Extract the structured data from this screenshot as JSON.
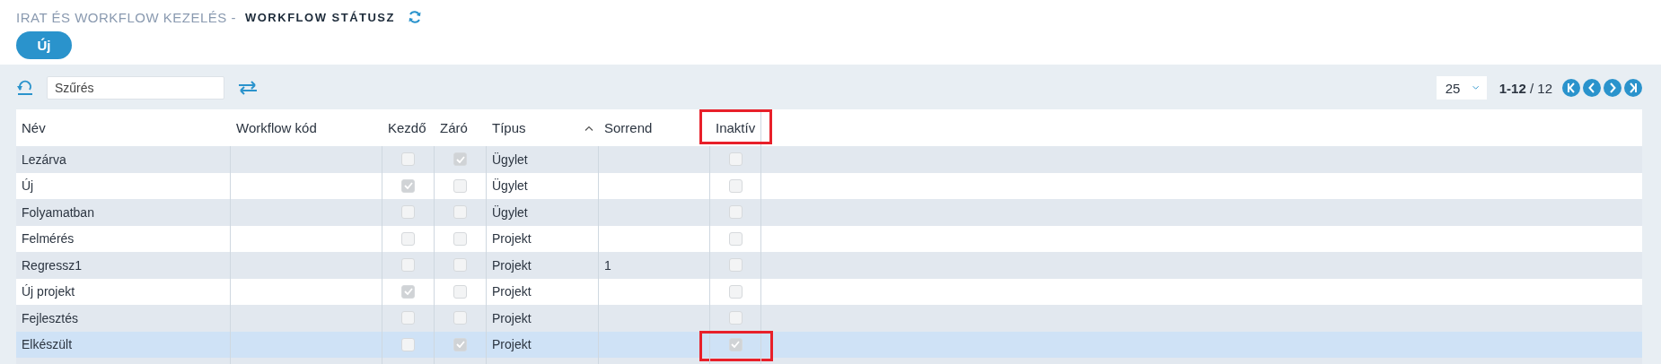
{
  "breadcrumb": {
    "parent": "IRAT ÉS WORKFLOW KEZELÉS -",
    "current": "WORKFLOW STÁTUSZ"
  },
  "new_button": "Új",
  "filter": {
    "placeholder": "Szűrés"
  },
  "pagination": {
    "page_size": "25",
    "range": "**1-12** / 12"
  },
  "columns": [
    {
      "label": "Név",
      "sorted": false,
      "highlighted": false
    },
    {
      "label": "Workflow kód",
      "sorted": false,
      "highlighted": false
    },
    {
      "label": "Kezdő",
      "sorted": false,
      "highlighted": false
    },
    {
      "label": "Záró",
      "sorted": false,
      "highlighted": false
    },
    {
      "label": "Típus",
      "sorted": true,
      "highlighted": false
    },
    {
      "label": "Sorrend",
      "sorted": false,
      "highlighted": false
    },
    {
      "label": "Inaktív",
      "sorted": false,
      "highlighted": true
    }
  ],
  "rows": [
    {
      "name": "Lezárva",
      "kezdo": false,
      "zaro": true,
      "type": "Ügylet",
      "inaktiv": false,
      "selected": false,
      "highlighted": false
    },
    {
      "name": "Új",
      "kezdo": true,
      "zaro": false,
      "type": "Ügylet",
      "inaktiv": false,
      "selected": false,
      "highlighted": false
    },
    {
      "name": "Folyamatban",
      "kezdo": false,
      "zaro": false,
      "type": "Ügylet",
      "inaktiv": false,
      "selected": false,
      "highlighted": false
    },
    {
      "name": "Felmérés",
      "kezdo": false,
      "zaro": false,
      "type": "Projekt",
      "inaktiv": false,
      "selected": false,
      "highlighted": false
    },
    {
      "name": "Regressz1",
      "kezdo": false,
      "zaro": false,
      "type": "Projekt",
      "order": "1",
      "inaktiv": false,
      "selected": false,
      "highlighted": false
    },
    {
      "name": "Új projekt",
      "kezdo": true,
      "zaro": false,
      "type": "Projekt",
      "inaktiv": false,
      "selected": false,
      "highlighted": false
    },
    {
      "name": "Fejlesztés",
      "kezdo": false,
      "zaro": false,
      "type": "Projekt",
      "inaktiv": false,
      "selected": false,
      "highlighted": false
    },
    {
      "name": "Elkészült",
      "kezdo": false,
      "zaro": true,
      "type": "Projekt",
      "inaktiv": true,
      "selected": true,
      "highlighted": true
    }
  ]
}
